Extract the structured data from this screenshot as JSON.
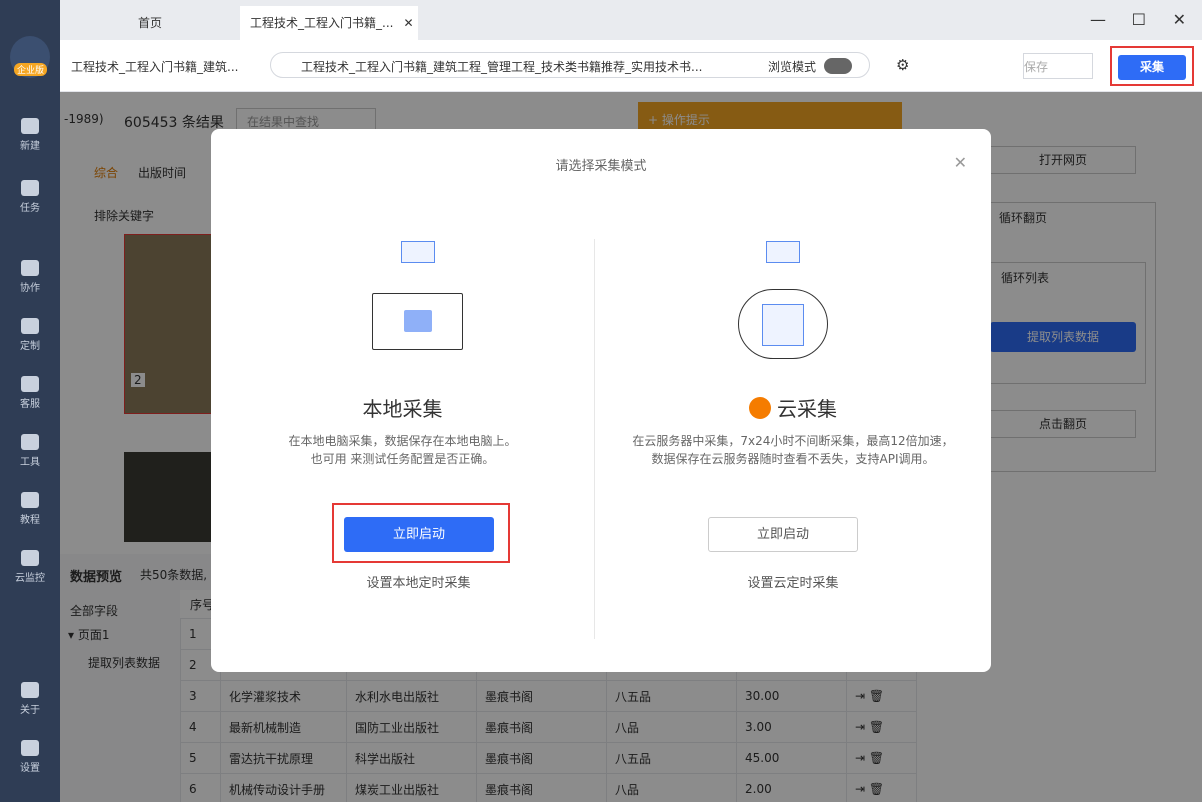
{
  "sidebar": {
    "badge": "企业版",
    "items": [
      {
        "label": "新建"
      },
      {
        "label": "任务"
      },
      {
        "label": "协作"
      },
      {
        "label": "定制"
      },
      {
        "label": "客服"
      },
      {
        "label": "工具"
      },
      {
        "label": "教程"
      },
      {
        "label": "云监控"
      },
      {
        "label": "关于"
      },
      {
        "label": "设置"
      }
    ]
  },
  "tabs": {
    "home": "首页",
    "active": "工程技术_工程入门书籍_..."
  },
  "header": {
    "title": "工程技术_工程入门书籍_建筑...",
    "url": "工程技术_工程入门书籍_建筑工程_管理工程_技术类书籍推荐_实用技术书...",
    "browse_mode": "浏览模式",
    "save": "保存",
    "collect": "采集"
  },
  "content": {
    "filter_tag": "-1989)",
    "result_count": "605453 条结果",
    "search_placeholder": "在结果中查找",
    "tip": "+ 操作提示",
    "sort1": "综合",
    "sort2": "出版时间",
    "exclude": "排除关键字",
    "img_num": "2"
  },
  "preview": {
    "title": "数据预览",
    "summary": "共50条数据,",
    "all_fields": "全部字段",
    "page": "▾ 页面1",
    "extract": "提取列表数据",
    "col_index": "序号",
    "rows": [
      [
        "1",
        "",
        "",
        "",
        "",
        ""
      ],
      [
        "2",
        "",
        "",
        "",
        "",
        ""
      ],
      [
        "3",
        "化学灌浆技术",
        "水利水电出版社",
        "墨痕书阁",
        "八五品",
        "30.00"
      ],
      [
        "4",
        "最新机械制造",
        "国防工业出版社",
        "墨痕书阁",
        "八品",
        "3.00"
      ],
      [
        "5",
        "雷达抗干扰原理",
        "科学出版社",
        "墨痕书阁",
        "八五品",
        "45.00"
      ],
      [
        "6",
        "机械传动设计手册",
        "煤炭工业出版社",
        "墨痕书阁",
        "八品",
        "2.00"
      ]
    ]
  },
  "flow": {
    "open": "打开网页",
    "loop_page": "循环翻页",
    "loop_list": "循环列表",
    "extract": "提取列表数据",
    "click_next": "点击翻页"
  },
  "modal": {
    "title": "请选择采集模式",
    "local": {
      "title": "本地采集",
      "desc1": "在本地电脑采集，数据保存在本地电脑上。",
      "desc2": "也可用 来测试任务配置是否正确。",
      "start": "立即启动",
      "schedule": "设置本地定时采集"
    },
    "cloud": {
      "title": "云采集",
      "desc1": "在云服务器中采集，7x24小时不间断采集，最高12倍加速，",
      "desc2": "数据保存在云服务器随时查看不丢失，支持API调用。",
      "start": "立即启动",
      "schedule": "设置云定时采集"
    }
  }
}
